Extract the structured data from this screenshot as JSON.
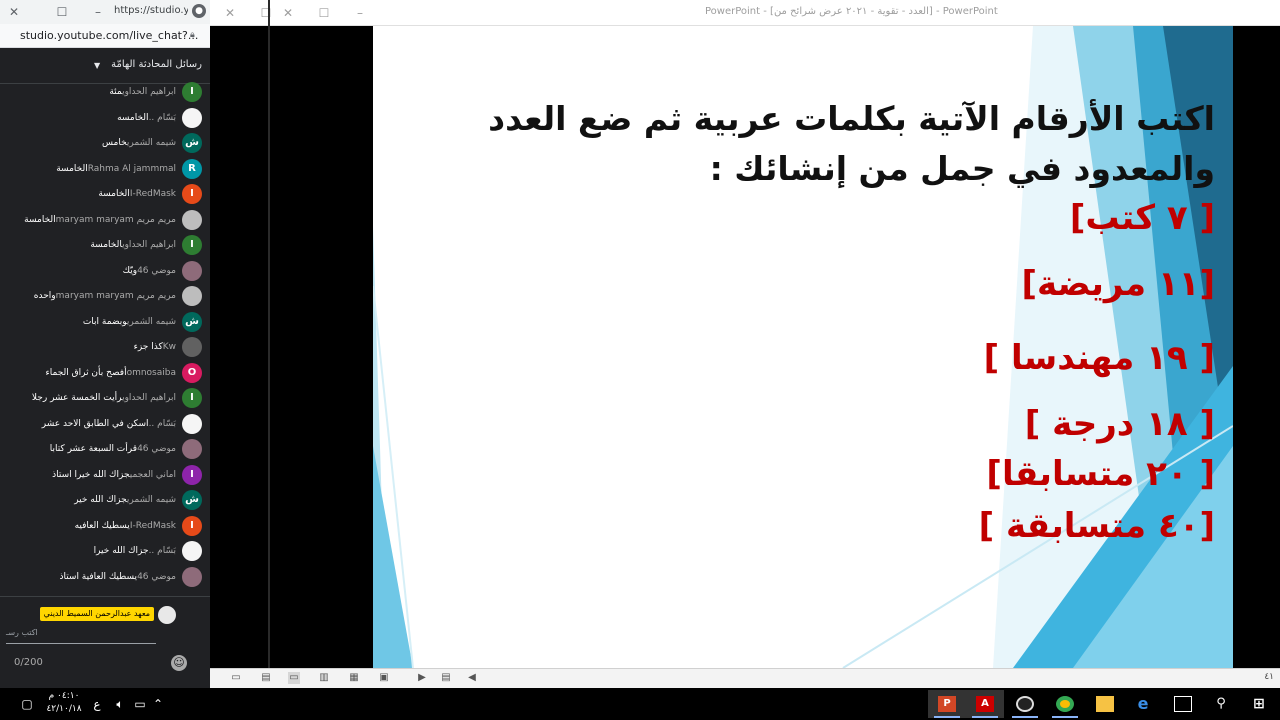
{
  "chat_window": {
    "tab_title": "https://studio.y...",
    "url": "studio.youtube.com/live_chat?...",
    "header_title": "رسائل المحادثة الهامّة",
    "messages": [
      {
        "author": "ابراهيم الحداوي",
        "text": "مئة",
        "avatar": "I",
        "color": "#2e7d32"
      },
      {
        "author": "بَسّام ..",
        "text": "الخامسه",
        "avatar": "",
        "color": "#f5f5f5"
      },
      {
        "author": "شيمه الشمري",
        "text": "خامس",
        "avatar": "ش",
        "color": "#00695c"
      },
      {
        "author": "Rahma Al jammmal",
        "text": "الخامسة",
        "avatar": "R",
        "color": "#0097a7"
      },
      {
        "author": "I-RedMask",
        "text": "الخامسة",
        "avatar": "I",
        "color": "#e64a19"
      },
      {
        "author": "مريم مريم maryam maryam",
        "text": "الخامسة",
        "avatar": "",
        "color": "#bdbdbd"
      },
      {
        "author": "ابراهيم الحداوي",
        "text": "الخامسة",
        "avatar": "I",
        "color": "#2e7d32"
      },
      {
        "author": "موضي 46",
        "text": "ويّك",
        "avatar": "",
        "color": "#8e6b7a"
      },
      {
        "author": "مريم مريم maryam maryam",
        "text": "واحده",
        "avatar": "",
        "color": "#bdbdbd"
      },
      {
        "author": "شيمه الشمري",
        "text": "وبضمة ابات",
        "avatar": "ش",
        "color": "#00695c"
      },
      {
        "author": "Kw",
        "text": "كذا جزء",
        "avatar": "",
        "color": "#616161"
      },
      {
        "author": "omnosaiba",
        "text": "أفصح بأن ثراق الجماء",
        "avatar": "O",
        "color": "#d81b60"
      },
      {
        "author": "ابراهيم الحداوي",
        "text": "رأيت الخمسة عشر رجلا",
        "avatar": "I",
        "color": "#2e7d32"
      },
      {
        "author": "بَسّام ..",
        "text": "اسكن في الطابق الاحد عشر",
        "avatar": "",
        "color": "#f5f5f5"
      },
      {
        "author": "موضي 46",
        "text": "قرأت السبعة عشر كتابا",
        "avatar": "",
        "color": "#8e6b7a"
      },
      {
        "author": "اماني العجمي",
        "text": "جزاك الله خيرا استاذ",
        "avatar": "I",
        "color": "#8e24aa"
      },
      {
        "author": "شيمه الشمري",
        "text": "جزاك الله خير",
        "avatar": "ش",
        "color": "#00695c"
      },
      {
        "author": "I-RedMask",
        "text": "يسطيك العافيه",
        "avatar": "I",
        "color": "#e64a19"
      },
      {
        "author": "بَسّام ..",
        "text": "جزاك الله خيرا",
        "avatar": "",
        "color": "#f5f5f5"
      },
      {
        "author": "موضي 46",
        "text": "يسطيك العافية استاذ",
        "avatar": "",
        "color": "#8e6b7a"
      }
    ],
    "composer": {
      "channel_badge": "معهد عبدالرحمن السميط الديني",
      "placeholder": "اكتب رسـ",
      "counter": "0/200"
    }
  },
  "ppt_window": {
    "title": "PowerPoint - [العدد - تقوية - ٢٠٢١ عرض شرائح من] - PowerPoint",
    "slide": {
      "heading": "اكتب الأرقام الآتية بكلمات عربية ثم ضع العدد والمعدود في جمل من إنشائك :",
      "items": [
        "[ ٧ كتب]",
        "[١١ مريضة]",
        "[ ١٩ مهندسا ]",
        "[ ١٨ درجة ]",
        "[ ٢٠ متسابقا]",
        "[٤٠ متسابقة ]"
      ],
      "colors": {
        "heading": "#111111",
        "items": "#c00000",
        "accent_dark": "#1f6b8f",
        "accent_light": "#8fd3ea"
      }
    },
    "status_right": "٤١"
  },
  "taskbar": {
    "time": "٠٤:١٠ م",
    "date": "٤٢/١٠/١٨",
    "lang": "ع",
    "apps": [
      "powerpoint-icon",
      "acrobat-icon",
      "obs-icon",
      "chrome-icon",
      "file-explorer-icon",
      "edge-icon",
      "task-view-icon",
      "search-icon",
      "windows-start-icon"
    ]
  }
}
